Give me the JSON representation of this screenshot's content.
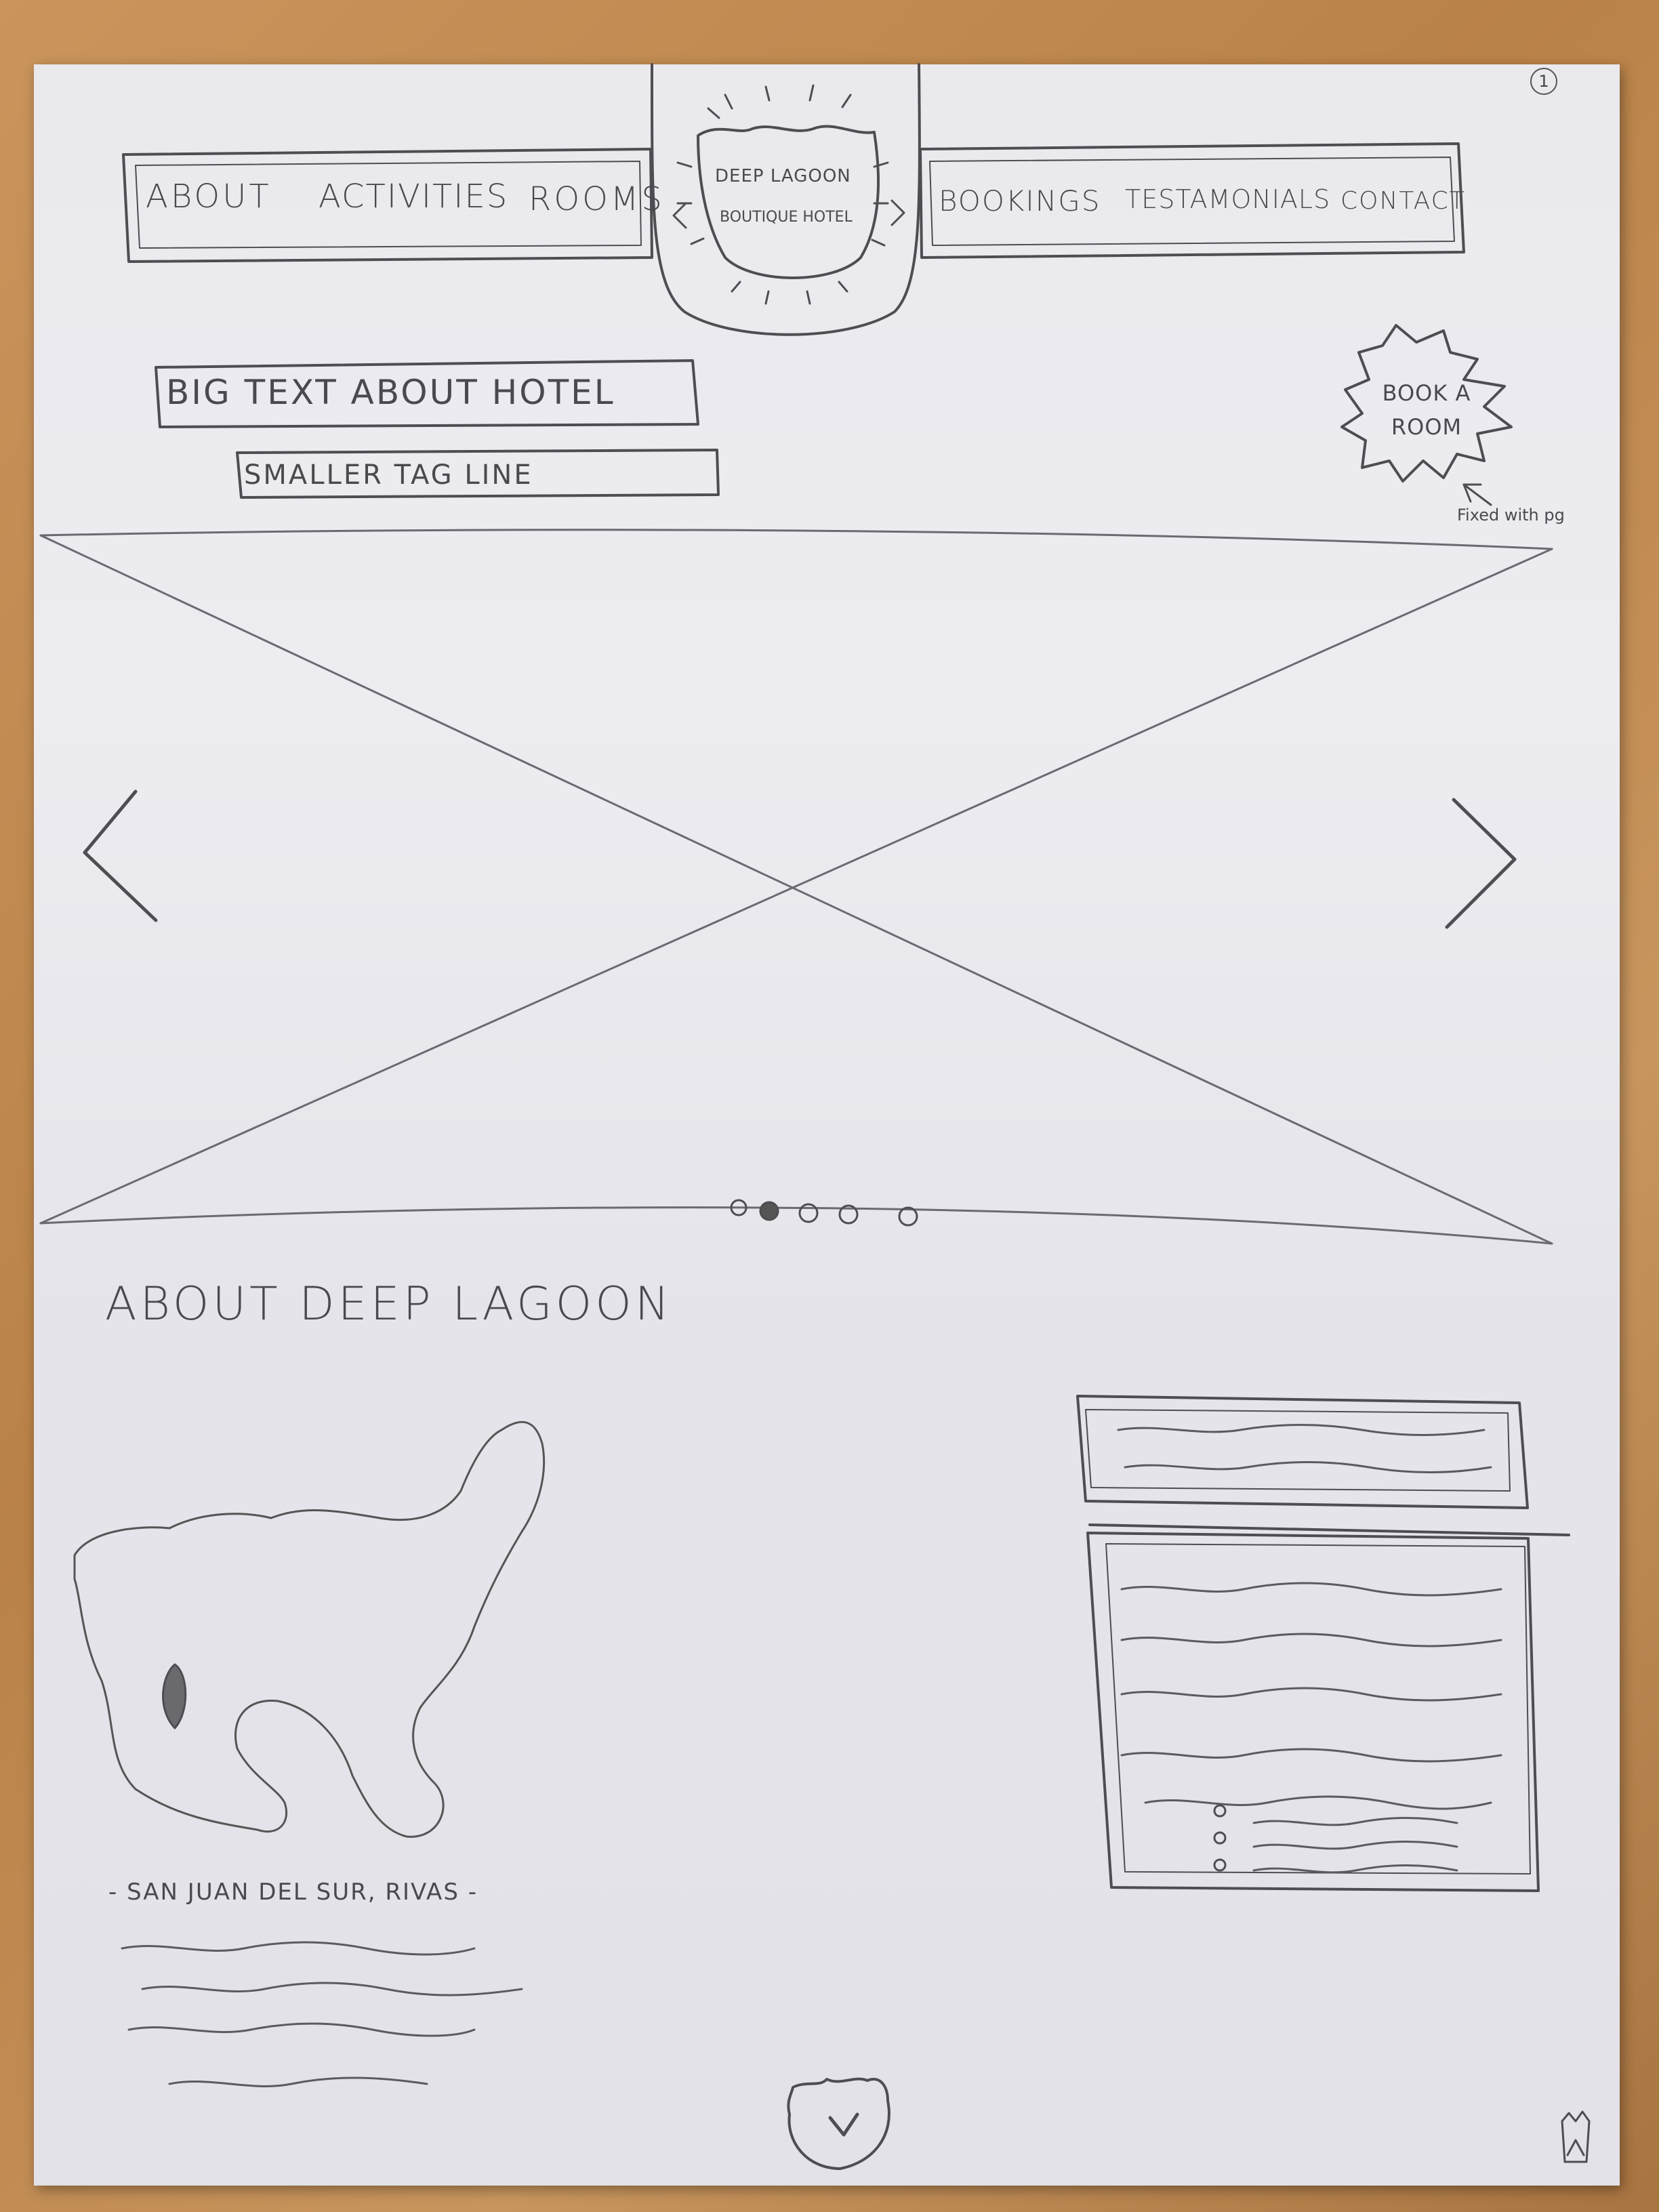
{
  "page_number": "1",
  "nav": {
    "left_items": [
      "About",
      "Activities",
      "Rooms"
    ],
    "right_items": [
      "Bookings",
      "Testamonials",
      "Contact"
    ]
  },
  "logo": {
    "line1": "Deep Lagoon",
    "line2": "Boutique Hotel"
  },
  "hero": {
    "headline": "Big text about hotel",
    "tagline": "Smaller tag line"
  },
  "book_badge": {
    "label": "Book A Room",
    "note": "Fixed with pg"
  },
  "carousel": {
    "dots": 5,
    "active_dot": 1
  },
  "about": {
    "heading": "About Deep Lagoon",
    "location": "- San Juan Del Sur, Rivas -"
  }
}
